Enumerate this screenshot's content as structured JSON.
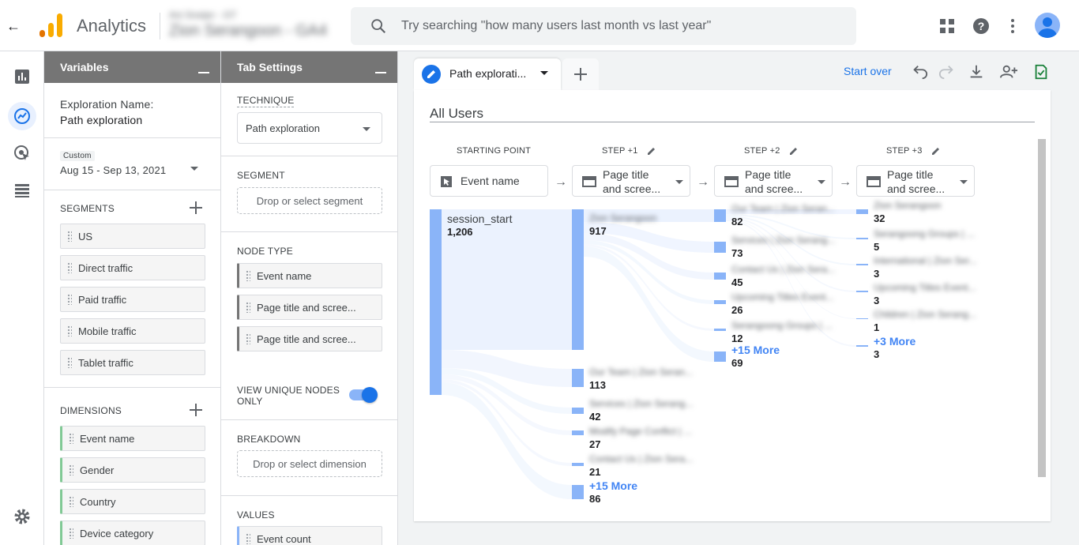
{
  "app": {
    "title": "Analytics",
    "account_line1": "Ani Sneijer - GT",
    "account_line2": "Zion Serangoon - GA4",
    "search_placeholder": "Try searching \"how many users last month vs last year\""
  },
  "variables": {
    "header": "Variables",
    "exploration_label": "Exploration Name:",
    "exploration_name": "Path exploration",
    "date_badge": "Custom",
    "date_range": "Aug 15 - Sep 13, 2021",
    "segments_title": "SEGMENTS",
    "segments": [
      "US",
      "Direct traffic",
      "Paid traffic",
      "Mobile traffic",
      "Tablet traffic"
    ],
    "dimensions_title": "DIMENSIONS",
    "dimensions": [
      "Event name",
      "Gender",
      "Country",
      "Device category"
    ]
  },
  "tab_settings": {
    "header": "Tab Settings",
    "technique_label": "TECHNIQUE",
    "technique_value": "Path exploration",
    "segment_label": "SEGMENT",
    "segment_drop": "Drop or select segment",
    "node_type_label": "NODE TYPE",
    "node_types": [
      "Event name",
      "Page title and scree...",
      "Page title and scree..."
    ],
    "unique_label_1": "VIEW UNIQUE NODES",
    "unique_label_2": "ONLY",
    "breakdown_label": "BREAKDOWN",
    "breakdown_drop": "Drop or select dimension",
    "values_label": "VALUES",
    "values_item": "Event count"
  },
  "canvas": {
    "tab_label": "Path explorati...",
    "start_over": "Start over",
    "segment_title": "All Users",
    "columns": [
      {
        "header": "STARTING POINT",
        "select_line1": "Event name",
        "select_line2": ""
      },
      {
        "header": "STEP +1",
        "select_line1": "Page title",
        "select_line2": "and scree..."
      },
      {
        "header": "STEP +2",
        "select_line1": "Page title",
        "select_line2": "and scree..."
      },
      {
        "header": "STEP +3",
        "select_line1": "Page title",
        "select_line2": "and scree..."
      }
    ],
    "start_node": {
      "label": "session_start",
      "value": "1,206"
    },
    "step1_nodes": [
      {
        "label": "Zion Serangoon",
        "value": "917"
      },
      {
        "label": "Our Team | Zion Seran...",
        "value": "113"
      },
      {
        "label": "Services | Zion Serang...",
        "value": "42"
      },
      {
        "label": "Modify Page Conflict | ...",
        "value": "27"
      },
      {
        "label": "Contact Us | Zion Sera...",
        "value": "21"
      }
    ],
    "step1_more": "+15 More",
    "step1_more_value": "86",
    "step2_nodes": [
      {
        "label": "Our Team | Zion Seran...",
        "value": "82"
      },
      {
        "label": "Services | Zion Serang...",
        "value": "73"
      },
      {
        "label": "Contact Us | Zion Sera...",
        "value": "45"
      },
      {
        "label": "Upcoming Titles Event...",
        "value": "26"
      },
      {
        "label": "Serangoong Groups | ...",
        "value": "12"
      }
    ],
    "step2_more": "+15 More",
    "step2_more_value": "69",
    "step3_nodes": [
      {
        "label": "Zion Serangoon",
        "value": "32"
      },
      {
        "label": "Serangoong Groups | ...",
        "value": "5"
      },
      {
        "label": "International | Zion Ser...",
        "value": "3"
      },
      {
        "label": "Upcoming Titles Event...",
        "value": "3"
      },
      {
        "label": "Children | Zion Serang...",
        "value": "1"
      }
    ],
    "step3_more": "+3 More",
    "step3_more_value": "3"
  },
  "colors": {
    "accent": "#1a73e8",
    "node": "#8ab4f8",
    "dimension_bar": "#81c995"
  }
}
